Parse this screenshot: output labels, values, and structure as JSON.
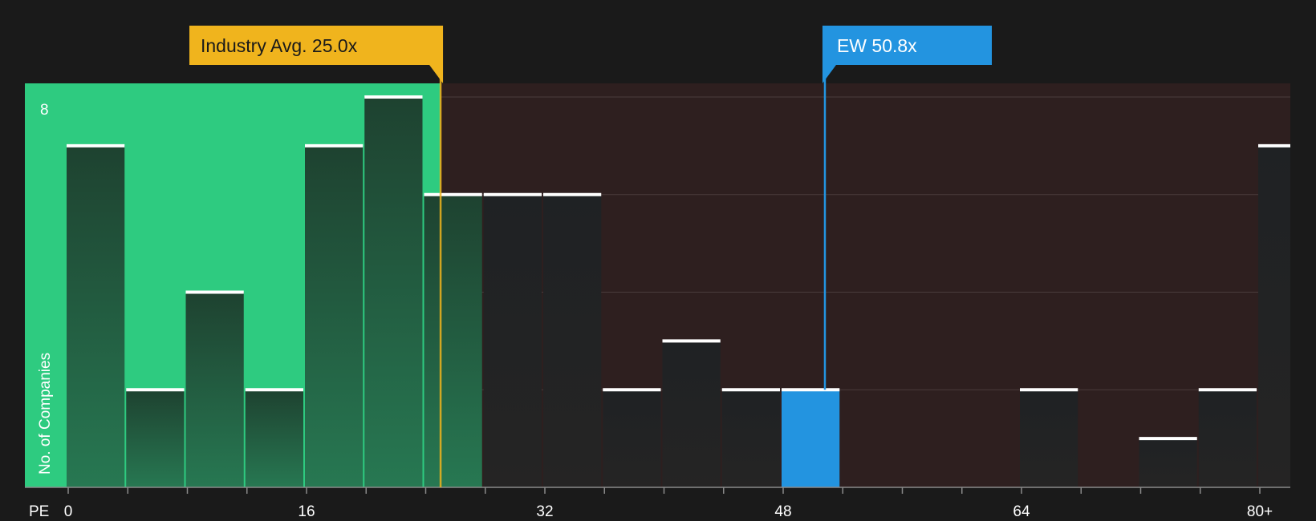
{
  "chart_data": {
    "type": "bar",
    "xlabel": "PE",
    "ylabel": "No. of Companies",
    "x_ticks": [
      "0",
      "16",
      "32",
      "48",
      "64",
      "80+"
    ],
    "y_ticks": [
      "8"
    ],
    "bins": [
      {
        "start": 0,
        "end": 4,
        "count": 7
      },
      {
        "start": 4,
        "end": 8,
        "count": 2
      },
      {
        "start": 8,
        "end": 12,
        "count": 4
      },
      {
        "start": 12,
        "end": 16,
        "count": 2
      },
      {
        "start": 16,
        "end": 20,
        "count": 7
      },
      {
        "start": 20,
        "end": 24,
        "count": 8
      },
      {
        "start": 24,
        "end": 28,
        "count": 6
      },
      {
        "start": 28,
        "end": 32,
        "count": 6
      },
      {
        "start": 32,
        "end": 36,
        "count": 6
      },
      {
        "start": 36,
        "end": 40,
        "count": 2
      },
      {
        "start": 40,
        "end": 44,
        "count": 3
      },
      {
        "start": 44,
        "end": 48,
        "count": 2
      },
      {
        "start": 48,
        "end": 52,
        "count": 2,
        "highlight": true
      },
      {
        "start": 64,
        "end": 68,
        "count": 2
      },
      {
        "start": 72,
        "end": 76,
        "count": 1
      },
      {
        "start": 76,
        "end": 80,
        "count": 2
      },
      {
        "start": 80,
        "end": 84,
        "count": 7
      }
    ],
    "xlim": [
      0,
      82
    ],
    "ylim": [
      0,
      8.3
    ],
    "industry_avg": {
      "label": "Industry Avg. 25.0x",
      "value": 25.0
    },
    "company": {
      "label": "EW 50.8x",
      "value": 50.8
    },
    "colors": {
      "background": "#1a1a1a",
      "below_avg_region": "#2ecb80",
      "above_avg_region": "#2e1f1f",
      "industry_avg": "#f0b41d",
      "company": "#2394e0",
      "bar_dark": "#22262a",
      "bar_cap": "#ffffff"
    }
  }
}
